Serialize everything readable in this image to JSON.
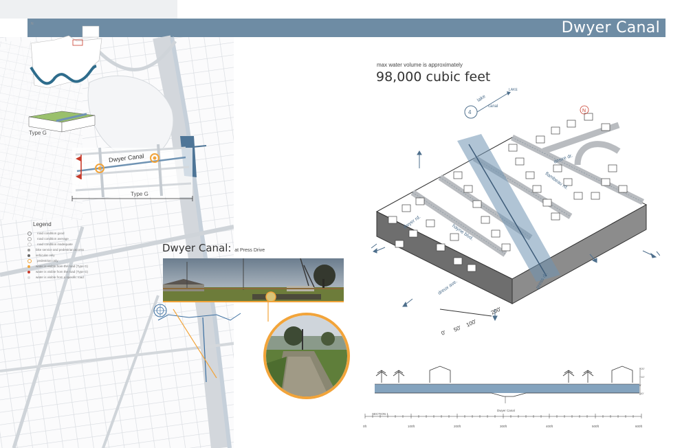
{
  "header": {
    "title": "Dwyer Canal"
  },
  "map": {
    "type_label_left": "Type G",
    "type_label_bottom": "Type G",
    "canal_label": "Dwyer Canal",
    "legend": {
      "title": "Legend",
      "items": [
        "road condition good",
        "road condition average",
        "road condition inadequate",
        "bike service and pedestrian access",
        "vehicular only",
        "pedestrian only",
        "water is visible from the road (Type G)",
        "water is visible from the road (Type G)",
        "water is visible from a specific road"
      ]
    }
  },
  "press": {
    "title": "Dwyer Canal:",
    "subtitle": "at Press Drive"
  },
  "volume": {
    "label": "max water volume is approximately",
    "value": "98,000 cubic feet"
  },
  "axonometric": {
    "street_labels": [
      "dwyer rd.",
      "hayne blvd.",
      "dreux ave.",
      "flambeau rd.",
      "desire dr.",
      "press dr."
    ],
    "callout_top": "lake",
    "callout_right": "LAKE",
    "callout_mid": "canal",
    "scale_labels": [
      "0'",
      "50'",
      "100'",
      "200'"
    ]
  },
  "section": {
    "label": "SECTION 1",
    "canal_label": "Dwyer Canal",
    "scale_ticks": [
      "0ft",
      "100ft",
      "200ft",
      "300ft",
      "400ft",
      "500ft",
      "600ft"
    ],
    "right_marks": [
      "+20'",
      "+10'",
      "0'",
      "-10'"
    ]
  },
  "colors": {
    "header": "#6e8ca4",
    "canal_blue": "#6f93b3",
    "accent_orange": "#f2a43a",
    "accent_red": "#c83a2a",
    "map_gray": "#d9dde2"
  }
}
